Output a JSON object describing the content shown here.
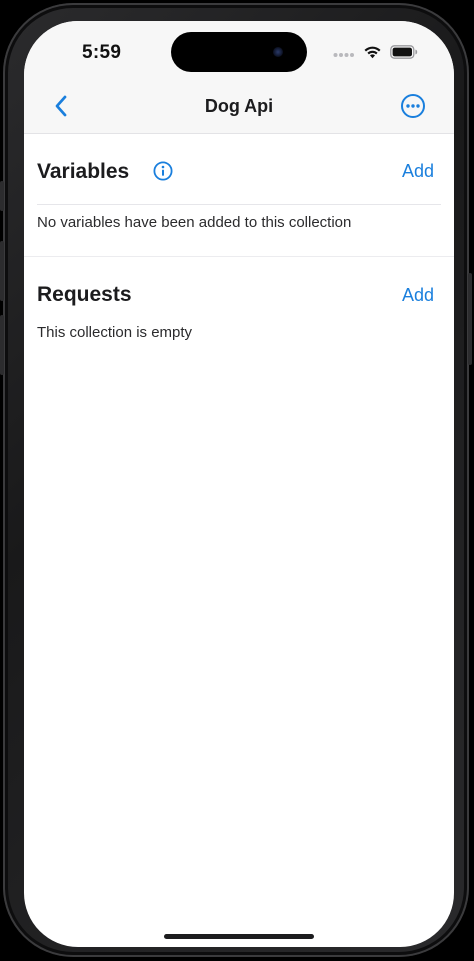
{
  "status_bar": {
    "time": "5:59",
    "icons": [
      "cellular-dots-icon",
      "wifi-icon",
      "battery-icon"
    ]
  },
  "nav": {
    "title": "Dog Api",
    "back_icon": "chevron-left-icon",
    "more_icon": "ellipsis-circle-icon"
  },
  "variables": {
    "title": "Variables",
    "info_icon": "info-circle-icon",
    "add_label": "Add",
    "empty_text": "No variables have been added to this collection"
  },
  "requests": {
    "title": "Requests",
    "add_label": "Add",
    "empty_text": "This collection is empty"
  },
  "colors": {
    "accent": "#1a7fdd",
    "text": "#1c1c1e",
    "nav_background": "#f7f7f7"
  }
}
